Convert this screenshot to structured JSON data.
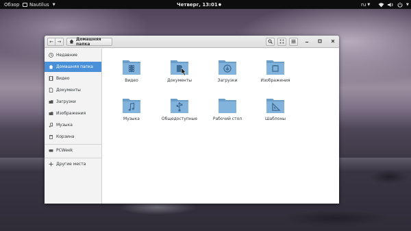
{
  "topbar": {
    "activities": "Обзор",
    "app_name": "Nautilus",
    "clock": "Четверг, 13:01",
    "clock_indicator": "●",
    "language": "ru",
    "status_icons": [
      "wifi-icon",
      "volume-icon",
      "power-icon"
    ]
  },
  "window": {
    "path_label": "Домашняя папка",
    "controls": [
      "search-icon",
      "view-grid-icon",
      "menu-icon",
      "minimize-icon",
      "maximize-icon",
      "close-icon"
    ]
  },
  "sidebar": {
    "items": [
      {
        "label": "Недавние",
        "icon": "clock-icon",
        "active": false
      },
      {
        "label": "Домашняя папка",
        "icon": "home-icon",
        "active": true
      },
      {
        "label": "Видео",
        "icon": "video-icon",
        "active": false
      },
      {
        "label": "Документы",
        "icon": "document-icon",
        "active": false
      },
      {
        "label": "Загрузки",
        "icon": "download-icon",
        "active": false
      },
      {
        "label": "Изображения",
        "icon": "image-icon",
        "active": false
      },
      {
        "label": "Музыка",
        "icon": "music-icon",
        "active": false
      },
      {
        "label": "Корзина",
        "icon": "trash-icon",
        "active": false
      },
      {
        "label": "PCWeek",
        "icon": "drive-icon",
        "active": false
      },
      {
        "label": "Другие места",
        "icon": "plus-icon",
        "active": false
      }
    ]
  },
  "folders": [
    {
      "label": "Видео",
      "emblem": "film-icon"
    },
    {
      "label": "Документы",
      "emblem": "document-icon"
    },
    {
      "label": "Загрузки",
      "emblem": "download-icon"
    },
    {
      "label": "Изображения",
      "emblem": "image-icon"
    },
    {
      "label": "Музыка",
      "emblem": "music-icon"
    },
    {
      "label": "Общедоступные",
      "emblem": "share-icon"
    },
    {
      "label": "Рабочий стол",
      "emblem": "desktop-icon"
    },
    {
      "label": "Шаблоны",
      "emblem": "template-icon"
    }
  ],
  "colors": {
    "accent": "#4a90d9",
    "folder_body": "#7fb0d8",
    "folder_emblem": "#3d6c96",
    "topbar": "#0d0d0e"
  }
}
